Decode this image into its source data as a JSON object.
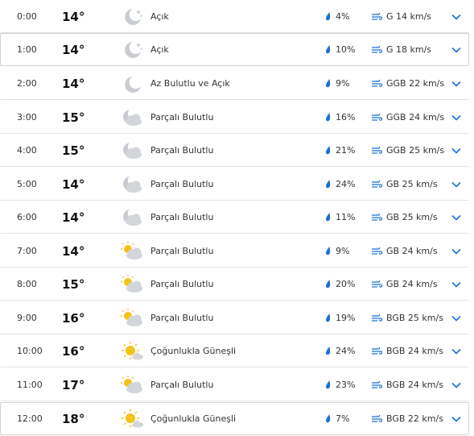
{
  "colors": {
    "accent": "#1b6fd6",
    "moon": "#c9cdd3",
    "cloud": "#d2d5da",
    "sun": "#f5c21b",
    "separator": "#e3e3e3",
    "text": "#333333"
  },
  "rows": [
    {
      "time": "0:00",
      "temp": "14°",
      "icon": "clear-night-icon",
      "condition": "Açık",
      "rain": "4%",
      "wind": "G 14 km/s"
    },
    {
      "time": "1:00",
      "temp": "14°",
      "icon": "clear-night-icon",
      "condition": "Açık",
      "rain": "10%",
      "wind": "G 18 km/s"
    },
    {
      "time": "2:00",
      "temp": "14°",
      "icon": "moon-icon",
      "condition": "Az Bulutlu ve Açık",
      "rain": "9%",
      "wind": "GGB 22 km/s"
    },
    {
      "time": "3:00",
      "temp": "15°",
      "icon": "partly-cloudy-night-icon",
      "condition": "Parçalı Bulutlu",
      "rain": "16%",
      "wind": "GGB 24 km/s"
    },
    {
      "time": "4:00",
      "temp": "15°",
      "icon": "partly-cloudy-night-icon",
      "condition": "Parçalı Bulutlu",
      "rain": "21%",
      "wind": "GGB 25 km/s"
    },
    {
      "time": "5:00",
      "temp": "14°",
      "icon": "partly-cloudy-night-icon",
      "condition": "Parçalı Bulutlu",
      "rain": "24%",
      "wind": "GB 25 km/s"
    },
    {
      "time": "6:00",
      "temp": "14°",
      "icon": "partly-cloudy-night-icon",
      "condition": "Parçalı Bulutlu",
      "rain": "11%",
      "wind": "GB 25 km/s"
    },
    {
      "time": "7:00",
      "temp": "14°",
      "icon": "partly-cloudy-day-icon",
      "condition": "Parçalı Bulutlu",
      "rain": "9%",
      "wind": "GB 24 km/s"
    },
    {
      "time": "8:00",
      "temp": "15°",
      "icon": "partly-cloudy-day-icon",
      "condition": "Parçalı Bulutlu",
      "rain": "20%",
      "wind": "GB 24 km/s"
    },
    {
      "time": "9:00",
      "temp": "16°",
      "icon": "partly-cloudy-day-icon",
      "condition": "Parçalı Bulutlu",
      "rain": "19%",
      "wind": "BGB 25 km/s"
    },
    {
      "time": "10:00",
      "temp": "16°",
      "icon": "mostly-sunny-icon",
      "condition": "Çoğunlukla Güneşli",
      "rain": "24%",
      "wind": "BGB 24 km/s"
    },
    {
      "time": "11:00",
      "temp": "17°",
      "icon": "partly-cloudy-day-icon",
      "condition": "Parçalı Bulutlu",
      "rain": "23%",
      "wind": "BGB 24 km/s"
    },
    {
      "time": "12:00",
      "temp": "18°",
      "icon": "mostly-sunny-icon",
      "condition": "Çoğunlukla Güneşli",
      "rain": "7%",
      "wind": "BGB 22 km/s"
    }
  ]
}
